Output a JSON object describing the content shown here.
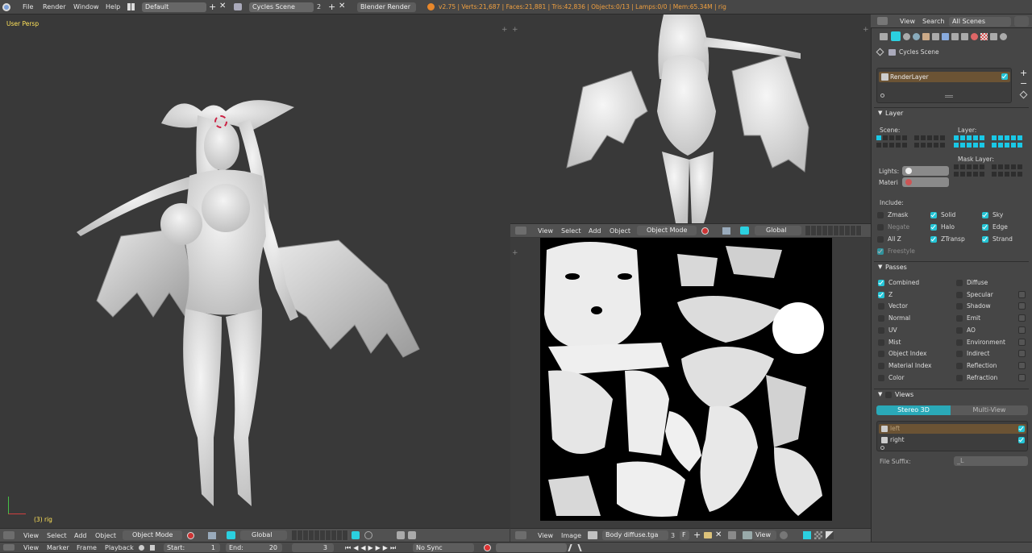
{
  "topbar": {
    "menus": [
      "File",
      "Render",
      "Window",
      "Help"
    ],
    "screen_layout": "Default",
    "scene": "Cycles Scene",
    "scene_users": "2",
    "engine": "Blender Render",
    "stats": "v2.75 | Verts:21,687 | Faces:21,881 | Tris:42,836 | Objects:0/13 | Lamps:0/0 | Mem:65.34M | rig"
  },
  "viewport_main": {
    "label": "User Persp",
    "object_label": "(3) rig",
    "header": {
      "menus": [
        "View",
        "Select",
        "Add",
        "Object"
      ],
      "mode": "Object Mode",
      "orientation": "Global"
    }
  },
  "viewport_back": {
    "header": {
      "menus": [
        "View",
        "Select",
        "Add",
        "Object"
      ],
      "mode": "Object Mode",
      "orientation": "Global"
    }
  },
  "uv_editor": {
    "header": {
      "menus": [
        "View",
        "Image"
      ],
      "image_name": "Body diffuse.tga",
      "image_users": "3",
      "fake_user": "F",
      "view_label": "View"
    }
  },
  "timeline": {
    "menus": [
      "View",
      "Marker",
      "Frame",
      "Playback"
    ],
    "start_label": "Start:",
    "start_value": "1",
    "end_label": "End:",
    "end_value": "20",
    "current_frame": "3",
    "sync": "No Sync"
  },
  "properties": {
    "header": {
      "menus": [
        "View",
        "Search"
      ],
      "filter": "All Scenes"
    },
    "breadcrumb": "Cycles Scene",
    "render_layer": "RenderLayer",
    "layer_panel": {
      "title": "Layer",
      "scene_label": "Scene:",
      "layer_label": "Layer:",
      "mask_layer_label": "Mask Layer:",
      "lights_label": "Lights:",
      "material_label": "Materi",
      "include_label": "Include:",
      "include": [
        {
          "label": "Zmask",
          "checked": false,
          "dim": false
        },
        {
          "label": "Solid",
          "checked": true,
          "dim": false
        },
        {
          "label": "Sky",
          "checked": true,
          "dim": false
        },
        {
          "label": "Negate",
          "checked": false,
          "dim": true
        },
        {
          "label": "Halo",
          "checked": true,
          "dim": false
        },
        {
          "label": "Edge",
          "checked": true,
          "dim": false
        },
        {
          "label": "All Z",
          "checked": false,
          "dim": false
        },
        {
          "label": "ZTransp",
          "checked": true,
          "dim": false
        },
        {
          "label": "Strand",
          "checked": true,
          "dim": false
        },
        {
          "label": "Freestyle",
          "checked": true,
          "dim": true
        }
      ]
    },
    "passes_panel": {
      "title": "Passes",
      "left": [
        {
          "label": "Combined",
          "checked": true
        },
        {
          "label": "Z",
          "checked": true
        },
        {
          "label": "Vector",
          "checked": false
        },
        {
          "label": "Normal",
          "checked": false
        },
        {
          "label": "UV",
          "checked": false
        },
        {
          "label": "Mist",
          "checked": false
        },
        {
          "label": "Object Index",
          "checked": false
        },
        {
          "label": "Material Index",
          "checked": false
        },
        {
          "label": "Color",
          "checked": false
        }
      ],
      "right": [
        {
          "label": "Diffuse",
          "checked": false
        },
        {
          "label": "Specular",
          "checked": false
        },
        {
          "label": "Shadow",
          "checked": false
        },
        {
          "label": "Emit",
          "checked": false
        },
        {
          "label": "AO",
          "checked": false
        },
        {
          "label": "Environment",
          "checked": false
        },
        {
          "label": "Indirect",
          "checked": false
        },
        {
          "label": "Reflection",
          "checked": false
        },
        {
          "label": "Refraction",
          "checked": false
        }
      ]
    },
    "views_panel": {
      "title": "Views",
      "tab_active": "Stereo 3D",
      "tab_inactive": "Multi-View",
      "views": [
        {
          "label": "left",
          "checked": true
        },
        {
          "label": "right",
          "checked": true
        }
      ],
      "suffix_label": "File Suffix:",
      "suffix_value": "_L"
    }
  },
  "colors": {
    "accent": "#19c8e6",
    "render_layer_bg": "#6b5334",
    "stats_text": "#f0a040"
  }
}
